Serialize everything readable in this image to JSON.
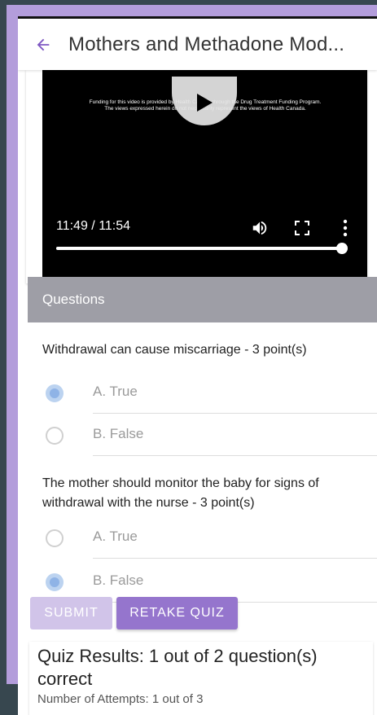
{
  "header": {
    "back_icon": "arrow-left-icon",
    "title": "Mothers and Methadone Mod..."
  },
  "video": {
    "caption_line1": "Funding for this video is provided by Health Canada through the Drug Treatment Funding Program.",
    "caption_line2": "The views expressed herein do not necessarily represent the views of Health Canada.",
    "time": "11:49 / 11:54",
    "progress_fraction": 0.986,
    "icons": [
      "play-icon",
      "volume-icon",
      "fullscreen-icon",
      "more-vert-icon"
    ]
  },
  "questions": {
    "header": "Questions",
    "items": [
      {
        "text": "Withdrawal can cause miscarriage - 3 point(s)",
        "options": [
          {
            "label": "A. True",
            "selected": true
          },
          {
            "label": "B. False",
            "selected": false
          }
        ]
      },
      {
        "text": "The mother should monitor the baby for signs of withdrawal with the nurse - 3 point(s)",
        "options": [
          {
            "label": "A. True",
            "selected": false
          },
          {
            "label": "B. False",
            "selected": true
          }
        ]
      }
    ]
  },
  "actions": {
    "submit_label": "SUBMIT",
    "retake_label": "RETAKE QUIZ"
  },
  "results": {
    "title": "Quiz Results: 1 out of 2 question(s) correct",
    "attempts": "Number of Attempts: 1 out of 3"
  },
  "colors": {
    "accent": "#9575cd",
    "frame": "#b39ddb",
    "questions_header": "#9e9ea6",
    "radio_selected": "#8fb3e6"
  }
}
